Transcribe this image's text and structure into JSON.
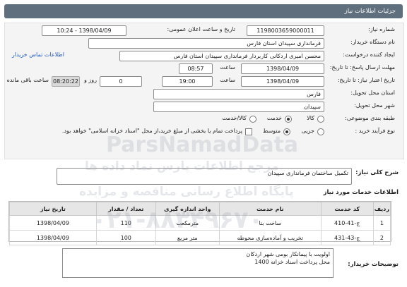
{
  "header": {
    "title": "جزئیات اطلاعات نیاز"
  },
  "form": {
    "need_number_label": "شماره نیاز:",
    "need_number": "1198003659000011",
    "announce_label": "تاریخ و ساعت اعلان عمومی:",
    "announce_value": "1398/04/09 - 10:24",
    "buyer_org_label": "نام دستگاه خریدار:",
    "buyer_org": "فرمانداری سپیدان استان فارس",
    "creator_label": "ایجاد کننده درخواست:",
    "creator": "محسن امیری اردکانی کاربردار فرمانداری سپیدان استان فارس",
    "contact_link": "اطلاعات تماس خریدار",
    "deadline_label": "مهلت ارسال پاسخ: تا تاریخ:",
    "deadline_date": "1398/04/09",
    "time_label": "ساعت",
    "deadline_time": "08:57",
    "validity_label": "تاریخ اعتبار نیاز: تا تاریخ:",
    "validity_date": "1398/04/09",
    "validity_time": "19:00",
    "days_value": "0",
    "days_label": "روز و",
    "remaining_time": "08:20:22",
    "remaining_label": "ساعت باقی مانده",
    "province_label": "استان محل تحویل:",
    "province": "فارس",
    "city_label": "شهر محل تحویل:",
    "city": "سپیدان",
    "category_label": "طبقه بندی موضوعی:",
    "category_options": [
      "کالا",
      "خدمت",
      "کالا/خدمت"
    ],
    "process_label": "نوع فرآیند خرید :",
    "process_options": [
      "جزیی",
      "متوسط"
    ],
    "payment_note": "پرداخت تمام یا بخشی از مبلغ خرید،از محل \"اسناد خزانه اسلامی\" خواهد بود."
  },
  "summary": {
    "label": "شرح کلی نیاز:",
    "value": "تکمیل ساختمان فرمانداری سپیدان"
  },
  "services": {
    "title": "اطلاعات خدمات مورد نیاز",
    "columns": [
      "ردیف",
      "کد خدمت",
      "نام خدمت",
      "واحد اندازه گیری",
      "تعداد / مقدار",
      "تاریخ نیاز"
    ],
    "rows": [
      [
        "1",
        "ج-41-410",
        "ساخت بنا",
        "مترمکعب",
        "110",
        "1398/04/09"
      ],
      [
        "2",
        "ج-43-431",
        "تخریب و آماده‌سازی محوطه",
        "متر مربع",
        "100",
        "1398/04/09"
      ]
    ]
  },
  "buyer_notes": {
    "label": "توضیحات خریدار:",
    "line1": "اولویت با پیمانکار بومی شهر اردکان",
    "line2": "محل پرداخت اسناد خزانه 1400"
  },
  "watermark": {
    "brand": "ParsNamadData",
    "line2": "مرجع اطلاعات پارس نماد داده ها",
    "line3": "پایگاه اطلاع رسانی مناقصه و مزایده",
    "phone": "۰۲۱-۸۸۳۴۹۶۷۰"
  }
}
